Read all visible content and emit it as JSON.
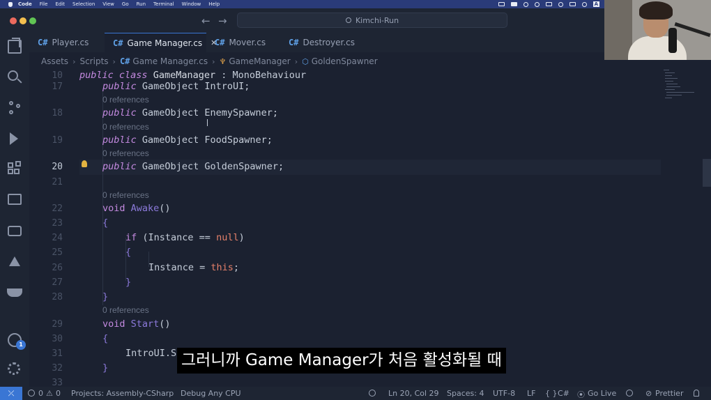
{
  "mac_menu": {
    "app": "Code",
    "items": [
      "File",
      "Edit",
      "Selection",
      "View",
      "Go",
      "Run",
      "Terminal",
      "Window",
      "Help"
    ],
    "tray_letter": "A"
  },
  "titlebar": {
    "search_text": "Kimchi-Run"
  },
  "tabs": [
    {
      "label": "Player.cs",
      "icon": "C#",
      "active": false
    },
    {
      "label": "Game Manager.cs",
      "icon": "C#",
      "active": true,
      "close": "✕"
    },
    {
      "label": "Mover.cs",
      "icon": "C#",
      "active": false
    },
    {
      "label": "Destroyer.cs",
      "icon": "C#",
      "active": false
    }
  ],
  "breadcrumb": {
    "parts": [
      "Assets",
      "Scripts",
      "Game Manager.cs",
      "GameManager",
      "GoldenSpawner"
    ]
  },
  "editor": {
    "sticky_line": {
      "num": "10",
      "kw": "public class",
      "name": "GameManager",
      "rest": " : MonoBehaviour"
    },
    "lines": {
      "l17": {
        "num": "17",
        "code": "GameObject IntroUI;"
      },
      "l18": {
        "num": "18",
        "code": "GameObject EnemySpawner;"
      },
      "l19": {
        "num": "19",
        "code": "GameObject FoodSpawner;"
      },
      "l20": {
        "num": "20",
        "code": "GameObject GoldenSpawner;"
      },
      "l21": {
        "num": "21"
      },
      "l22": {
        "num": "22",
        "kw": "void",
        "name": "Awake",
        "rest": "()"
      },
      "l23": {
        "num": "23",
        "code": "{"
      },
      "l24": {
        "num": "24",
        "kw": "if",
        "code": "(Instance == ",
        "lit": "null",
        "end": ")"
      },
      "l25": {
        "num": "25",
        "code": "{"
      },
      "l26": {
        "num": "26",
        "code": "Instance = ",
        "lit": "this",
        "end": ";"
      },
      "l27": {
        "num": "27",
        "code": "}"
      },
      "l28": {
        "num": "28",
        "code": "}"
      },
      "l29": {
        "num": "29",
        "kw": "void",
        "name": "Start",
        "rest": "()"
      },
      "l30": {
        "num": "30",
        "code": "{"
      },
      "l31": {
        "num": "31",
        "code": "IntroUI.S"
      },
      "l32": {
        "num": "32",
        "code": "}"
      },
      "l33": {
        "num": "33"
      }
    },
    "public_kw": "public",
    "codelens": "0 references"
  },
  "subtitle": "그러니까 Game Manager가 처음 활성화될 때",
  "activity": {
    "badge": "1"
  },
  "status": {
    "remote": "⤫",
    "errors": "0",
    "warnings": "0",
    "projects": "Projects: Assembly-CSharp",
    "config": "Debug Any CPU",
    "position": "Ln 20, Col 29",
    "spaces": "Spaces: 4",
    "encoding": "UTF-8",
    "eol": "LF",
    "language": "C#",
    "braces": "{ }",
    "golive": "Go Live",
    "prettier": "Prettier"
  }
}
